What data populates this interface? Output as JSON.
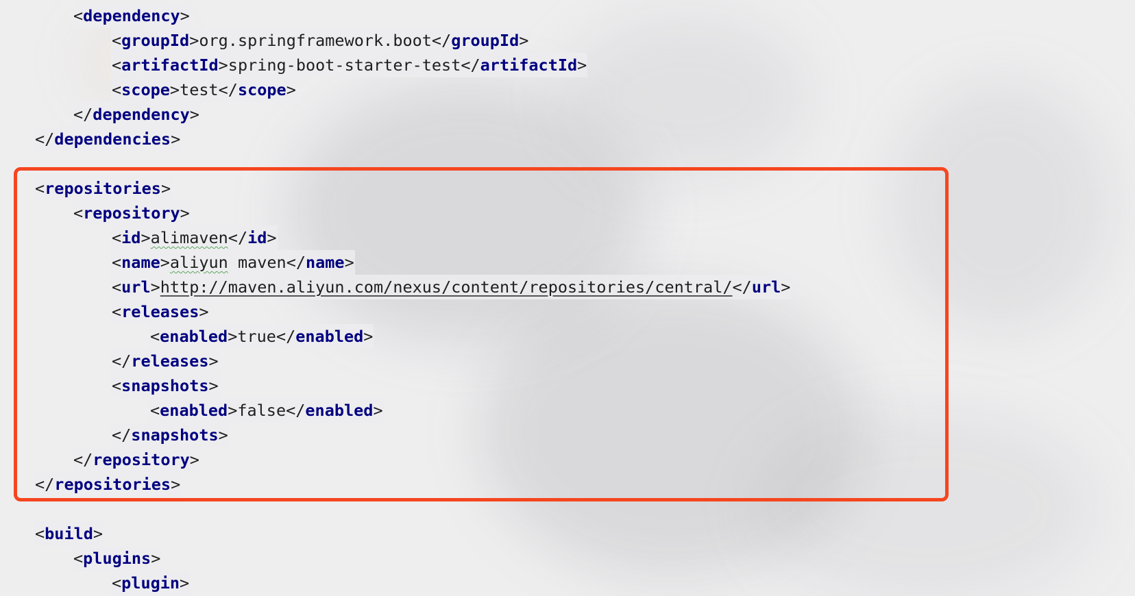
{
  "editor": {
    "highlight_color": "#f5461f",
    "tag_color": "#000080",
    "lines": [
      {
        "indent": 2,
        "parts": [
          {
            "t": "<",
            "k": "b"
          },
          {
            "t": "dependency",
            "k": "n"
          },
          {
            "t": ">",
            "k": "b"
          }
        ]
      },
      {
        "indent": 3,
        "parts": [
          {
            "t": "<",
            "k": "b"
          },
          {
            "t": "groupId",
            "k": "n"
          },
          {
            "t": ">",
            "k": "b"
          },
          {
            "t": "org.springframework.boot",
            "k": "x"
          },
          {
            "t": "</",
            "k": "b"
          },
          {
            "t": "groupId",
            "k": "n"
          },
          {
            "t": ">",
            "k": "b"
          }
        ]
      },
      {
        "indent": 3,
        "parts": [
          {
            "t": "<",
            "k": "b"
          },
          {
            "t": "artifactId",
            "k": "n"
          },
          {
            "t": ">",
            "k": "b"
          },
          {
            "t": "spring-boot-starter-test",
            "k": "x"
          },
          {
            "t": "</",
            "k": "b"
          },
          {
            "t": "artifactId",
            "k": "n"
          },
          {
            "t": ">",
            "k": "b"
          }
        ]
      },
      {
        "indent": 3,
        "parts": [
          {
            "t": "<",
            "k": "b"
          },
          {
            "t": "scope",
            "k": "n"
          },
          {
            "t": ">",
            "k": "b"
          },
          {
            "t": "test",
            "k": "x"
          },
          {
            "t": "</",
            "k": "b"
          },
          {
            "t": "scope",
            "k": "n"
          },
          {
            "t": ">",
            "k": "b"
          }
        ]
      },
      {
        "indent": 2,
        "parts": [
          {
            "t": "</",
            "k": "b"
          },
          {
            "t": "dependency",
            "k": "n"
          },
          {
            "t": ">",
            "k": "b"
          }
        ]
      },
      {
        "indent": 1,
        "parts": [
          {
            "t": "</",
            "k": "b"
          },
          {
            "t": "dependencies",
            "k": "n"
          },
          {
            "t": ">",
            "k": "b"
          }
        ]
      },
      {
        "indent": 1,
        "parts": []
      },
      {
        "indent": 1,
        "parts": [
          {
            "t": "<",
            "k": "b"
          },
          {
            "t": "repositories",
            "k": "n"
          },
          {
            "t": ">",
            "k": "b"
          }
        ]
      },
      {
        "indent": 2,
        "parts": [
          {
            "t": "<",
            "k": "b"
          },
          {
            "t": "repository",
            "k": "n"
          },
          {
            "t": ">",
            "k": "b"
          }
        ]
      },
      {
        "indent": 3,
        "parts": [
          {
            "t": "<",
            "k": "b"
          },
          {
            "t": "id",
            "k": "n"
          },
          {
            "t": ">",
            "k": "b"
          },
          {
            "t": "alimaven",
            "k": "s"
          },
          {
            "t": "</",
            "k": "b"
          },
          {
            "t": "id",
            "k": "n"
          },
          {
            "t": ">",
            "k": "b"
          }
        ]
      },
      {
        "indent": 3,
        "parts": [
          {
            "t": "<",
            "k": "b"
          },
          {
            "t": "name",
            "k": "n"
          },
          {
            "t": ">",
            "k": "b"
          },
          {
            "t": "aliyun",
            "k": "s"
          },
          {
            "t": " maven",
            "k": "x"
          },
          {
            "t": "</",
            "k": "b"
          },
          {
            "t": "name",
            "k": "n"
          },
          {
            "t": ">",
            "k": "b"
          }
        ]
      },
      {
        "indent": 3,
        "parts": [
          {
            "t": "<",
            "k": "b"
          },
          {
            "t": "url",
            "k": "n"
          },
          {
            "t": ">",
            "k": "b"
          },
          {
            "t": "http://maven.aliyun.com/nexus/content/repositories/central/",
            "k": "l"
          },
          {
            "t": "</",
            "k": "b"
          },
          {
            "t": "url",
            "k": "n"
          },
          {
            "t": ">",
            "k": "b"
          }
        ]
      },
      {
        "indent": 3,
        "parts": [
          {
            "t": "<",
            "k": "b"
          },
          {
            "t": "releases",
            "k": "n"
          },
          {
            "t": ">",
            "k": "b"
          }
        ]
      },
      {
        "indent": 4,
        "parts": [
          {
            "t": "<",
            "k": "b"
          },
          {
            "t": "enabled",
            "k": "n"
          },
          {
            "t": ">",
            "k": "b"
          },
          {
            "t": "true",
            "k": "x"
          },
          {
            "t": "</",
            "k": "b"
          },
          {
            "t": "enabled",
            "k": "n"
          },
          {
            "t": ">",
            "k": "b"
          }
        ]
      },
      {
        "indent": 3,
        "parts": [
          {
            "t": "</",
            "k": "b"
          },
          {
            "t": "releases",
            "k": "n"
          },
          {
            "t": ">",
            "k": "b"
          }
        ]
      },
      {
        "indent": 3,
        "parts": [
          {
            "t": "<",
            "k": "b"
          },
          {
            "t": "snapshots",
            "k": "n"
          },
          {
            "t": ">",
            "k": "b"
          }
        ]
      },
      {
        "indent": 4,
        "parts": [
          {
            "t": "<",
            "k": "b"
          },
          {
            "t": "enabled",
            "k": "n"
          },
          {
            "t": ">",
            "k": "b"
          },
          {
            "t": "false",
            "k": "x"
          },
          {
            "t": "</",
            "k": "b"
          },
          {
            "t": "enabled",
            "k": "n"
          },
          {
            "t": ">",
            "k": "b"
          }
        ]
      },
      {
        "indent": 3,
        "parts": [
          {
            "t": "</",
            "k": "b"
          },
          {
            "t": "snapshots",
            "k": "n"
          },
          {
            "t": ">",
            "k": "b"
          }
        ]
      },
      {
        "indent": 2,
        "parts": [
          {
            "t": "</",
            "k": "b"
          },
          {
            "t": "repository",
            "k": "n"
          },
          {
            "t": ">",
            "k": "b"
          }
        ]
      },
      {
        "indent": 1,
        "parts": [
          {
            "t": "</",
            "k": "b"
          },
          {
            "t": "repositories",
            "k": "n"
          },
          {
            "t": ">",
            "k": "b"
          }
        ]
      },
      {
        "indent": 1,
        "parts": []
      },
      {
        "indent": 1,
        "parts": [
          {
            "t": "<",
            "k": "b"
          },
          {
            "t": "build",
            "k": "n"
          },
          {
            "t": ">",
            "k": "b"
          }
        ]
      },
      {
        "indent": 2,
        "parts": [
          {
            "t": "<",
            "k": "b"
          },
          {
            "t": "plugins",
            "k": "n"
          },
          {
            "t": ">",
            "k": "b"
          }
        ]
      },
      {
        "indent": 3,
        "parts": [
          {
            "t": "<",
            "k": "b"
          },
          {
            "t": "plugin",
            "k": "n"
          },
          {
            "t": ">",
            "k": "b"
          }
        ]
      }
    ]
  }
}
